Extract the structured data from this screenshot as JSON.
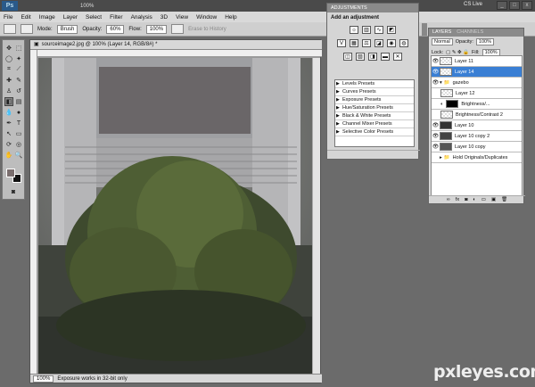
{
  "app": {
    "logo": "Ps",
    "zoom": "100%",
    "cs_live": "CS Live",
    "win_min": "_",
    "win_max": "□",
    "win_close": "x"
  },
  "menu": [
    "File",
    "Edit",
    "Image",
    "Layer",
    "Select",
    "Filter",
    "Analysis",
    "3D",
    "View",
    "Window",
    "Help"
  ],
  "options": {
    "mode_label": "Mode:",
    "mode_value": "Brush",
    "opacity_label": "Opacity:",
    "opacity_value": "60%",
    "flow_label": "Flow:",
    "flow_value": "100%",
    "erase_to_history": "Erase to History"
  },
  "document": {
    "title": "sourceimage2.jpg @ 100% (Layer 14, RGB/8#) *",
    "zoom": "100%",
    "status": "Exposure works in 32-bit only"
  },
  "adjustments": {
    "tab": "ADJUSTMENTS",
    "title": "Add an adjustment",
    "presets": [
      "Levels Presets",
      "Curves Presets",
      "Exposure Presets",
      "Hue/Saturation Presets",
      "Black & White Presets",
      "Channel Mixer Presets",
      "Selective Color Presets"
    ]
  },
  "layers_panel": {
    "tabs": [
      "LAYERS",
      "CHANNELS"
    ],
    "blend_mode": "Normal",
    "opacity_label": "Opacity:",
    "opacity_value": "100%",
    "lock_label": "Lock:",
    "fill_label": "Fill:",
    "fill_value": "100%",
    "layers": [
      {
        "name": "Layer 11"
      },
      {
        "name": "Layer 14"
      },
      {
        "name": "gazebo"
      },
      {
        "name": "Layer 12"
      },
      {
        "name": "Brightness/..."
      },
      {
        "name": "Brightness/Contrast 2"
      },
      {
        "name": "Layer 10"
      },
      {
        "name": "Layer 10 copy 2"
      },
      {
        "name": "Layer 10 copy"
      },
      {
        "name": "Hold Originals/Duplicates"
      }
    ]
  },
  "watermark": "pxleyes.com"
}
